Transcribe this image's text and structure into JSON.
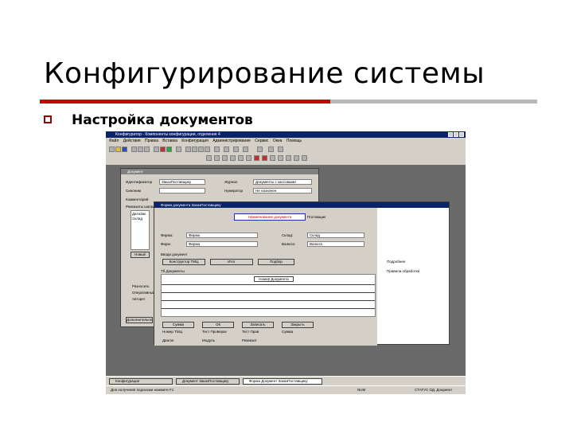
{
  "slide": {
    "title": "Конфигурирование системы",
    "bullet": "Настройка документов"
  },
  "app": {
    "title": "Конфигуратор - Компоненты конфигурации, отделение 4",
    "menu": [
      "Файл",
      "Действия",
      "Правка",
      "Вставка",
      "Конфигурация",
      "Администрирование",
      "Сервис",
      "Окна",
      "Помощь"
    ]
  },
  "doc_window": {
    "caption": "Документ",
    "name_label": "Идентификатор",
    "name_value": "ЗаказПоставщику",
    "synonym_label": "Синоним",
    "comment_label": "Комментарий",
    "type_label": "Журнал",
    "type_value": "Документы с кассовыми",
    "numbering_label": "Нумератор",
    "numbering_value": "Не назначен",
    "list_label": "Реквизиты шапки",
    "list_items": [
      "ДатаЗак",
      "Склад"
    ],
    "new_button": "Новый",
    "check_items": [
      "Разносить",
      "Оперативный",
      "Авторег"
    ],
    "bottom_label": "Дополнительно"
  },
  "form_window": {
    "caption": "Форма документа ЗаказПоставщику",
    "header_text": "Поставщик",
    "big_label": "Наименование документа",
    "field1_label": "Фирма:",
    "field1_value": "Фирма",
    "field2_label": "Фирм:",
    "field2_value": "Фирма",
    "field3_label": "Склад:",
    "field3_value": "Склад",
    "field4_label": "Валюта:",
    "field4_value": "Валюта",
    "doc_section": "Вводи документ",
    "btn_a": "Конструктор ТМЦ",
    "btn_b": "Итог",
    "btn_c": "Подбор",
    "table_title": "Тб Документы",
    "table_cell": "Номер Документа",
    "footer_labels": [
      "Сумма",
      "ОК",
      "Записать",
      "Закрыть"
    ],
    "footer_values": [
      "Номер ТМЦ",
      "Тест Проверки",
      "Тест Прав",
      "Сумма"
    ],
    "bottom_tabs": [
      "Диалог",
      "Модуль",
      "Реквизит"
    ],
    "right_check": "Подробнее",
    "right_note": "Правила обработки"
  },
  "taskbar": {
    "items": [
      "Конфигурация",
      "Документ ЗаказПоставщику",
      "Форма Документ ЗаказПоставщику"
    ]
  },
  "status": {
    "left": "Для получения подсказки нажмите F1",
    "mid": "NUM",
    "right": "СТАТУС ОД. Документ"
  }
}
